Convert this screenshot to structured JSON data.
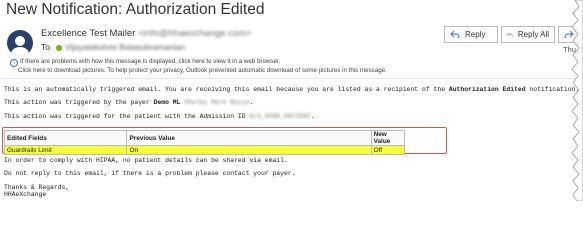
{
  "window": {
    "title": "New Notification: Authorization Edited"
  },
  "sender": {
    "name": "Excellence Test Mailer",
    "email": "<info@hhaexchange.com>"
  },
  "recipient": {
    "label": "To",
    "name": "Vijayalakshmi Balasubramanian"
  },
  "actions": {
    "reply": "Reply",
    "reply_all": "Reply All",
    "forward": "Fo"
  },
  "date": "Thu 1",
  "info_bar": {
    "line1": "If there are problems with how this message is displayed, click here to view it in a web browser.",
    "line2": "Click here to download pictures. To help protect your privacy, Outlook prevented automatic download of some pictures in this message."
  },
  "body": {
    "p1_pre": "This is an automatically triggered email. You are receiving this email because you are listed as a recipient of the ",
    "p1_bold": "Authorization Edited",
    "p1_post": " notification.",
    "p2_pre": "This action was triggered by the payer ",
    "p2_payer": "Demo ML",
    "p2_redact": "Shelby Mark Ninja",
    "p2_post": ".",
    "p3_pre": "This action was triggered for the patient with the Admission ID ",
    "p3_redact": "ELS_8990_PATIENT",
    "p3_post": ".",
    "p4": "In order to comply with HIPAA, no patient details can be shared via email.",
    "p5": "Do not reply to this email, if there is a problem please contact your payer.",
    "sign1": "Thanks & Regards,",
    "sign2": "HHAeXchange"
  },
  "table": {
    "headers": [
      "Edited Fields",
      "Previous Value",
      "New Value"
    ],
    "rows": [
      [
        "Guardrails Limit",
        "On",
        "Off"
      ]
    ]
  },
  "colors": {
    "highlight": "#f6ff3c",
    "frame": "#d9534f",
    "avatar": "#2a3f6b",
    "presence": "#6bb700"
  }
}
